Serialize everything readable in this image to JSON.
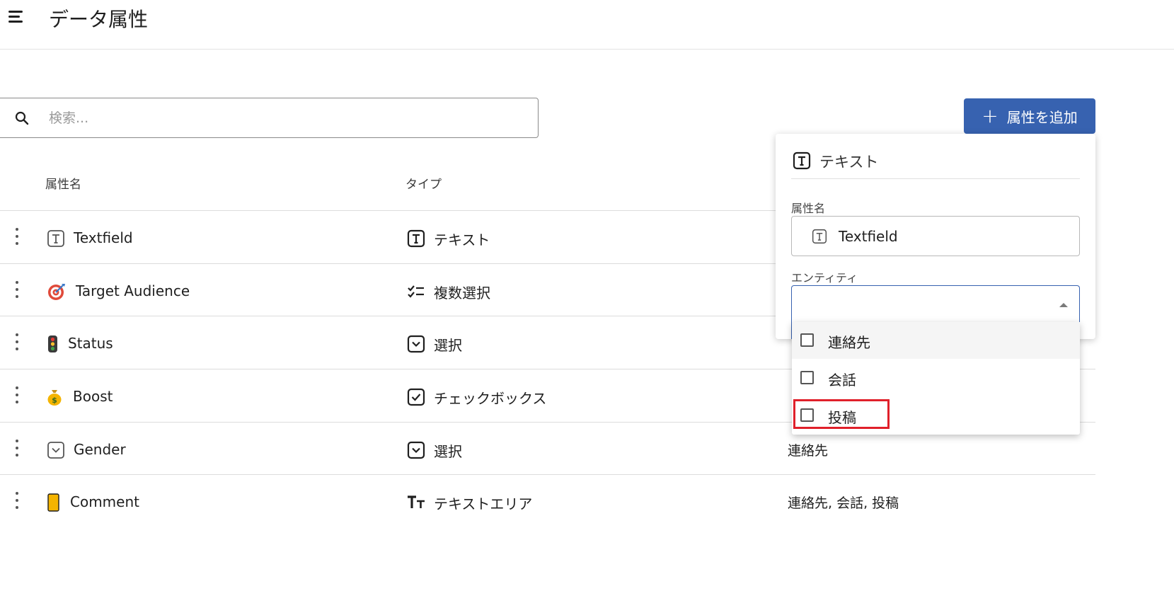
{
  "header": {
    "title": "データ属性",
    "menu_icon": "hamburger-menu-icon"
  },
  "search": {
    "placeholder": "検索..."
  },
  "add_button": {
    "label": "属性を追加"
  },
  "columns": {
    "name": "属性名",
    "type": "タイプ"
  },
  "rows": [
    {
      "icon": "text-field-icon",
      "name": "Textfield",
      "type_icon": "text-type-icon",
      "type": "テキスト",
      "entities": ""
    },
    {
      "icon": "target-icon",
      "name": "Target Audience",
      "type_icon": "checklist-icon",
      "type": "複数選択",
      "entities": ""
    },
    {
      "icon": "traffic-light-icon",
      "name": "Status",
      "type_icon": "dropdown-icon",
      "type": "選択",
      "entities": ""
    },
    {
      "icon": "money-bag-icon",
      "name": "Boost",
      "type_icon": "checkbox-icon",
      "type": "チェックボックス",
      "entities": ""
    },
    {
      "icon": "dropdown-icon",
      "name": "Gender",
      "type_icon": "dropdown-icon",
      "type": "選択",
      "entities": "連絡先"
    },
    {
      "icon": "note-icon",
      "name": "Comment",
      "type_icon": "text-area-icon",
      "type": "テキストエリア",
      "entities": "連絡先, 会話, 投稿"
    }
  ],
  "panel": {
    "title": "テキスト",
    "name_label": "属性名",
    "name_value": "Textfield",
    "entity_label": "エンティティ",
    "entity_value": ""
  },
  "dropdown": {
    "options": [
      {
        "label": "連絡先",
        "checked": false
      },
      {
        "label": "会話",
        "checked": false
      },
      {
        "label": "投稿",
        "checked": false
      }
    ]
  },
  "colors": {
    "accent": "#3762b0",
    "highlight": "#e0202a"
  }
}
